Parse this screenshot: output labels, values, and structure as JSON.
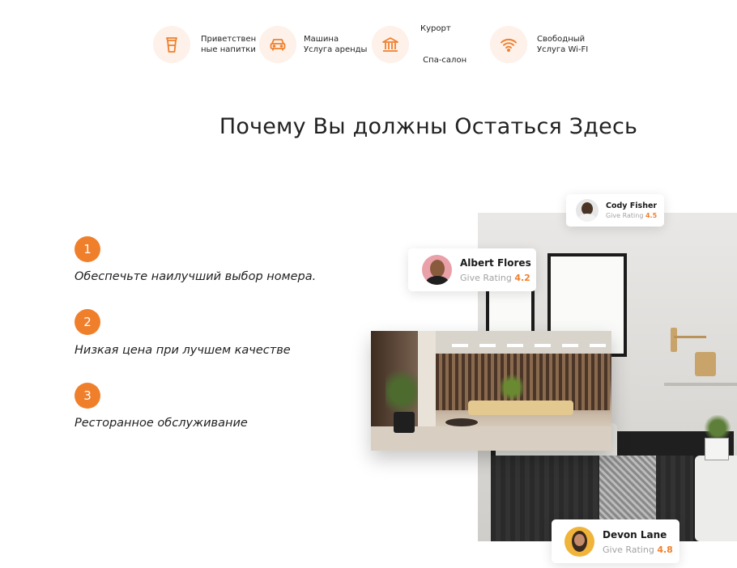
{
  "amenities": [
    {
      "icon": "cup-icon",
      "lines": [
        "Приветствен",
        "ные напитки"
      ]
    },
    {
      "icon": "car-icon",
      "lines": [
        "Машина",
        "Услуга аренды"
      ]
    },
    {
      "icon": "spa-building-icon",
      "lines": [
        "Курорт",
        " Спа-салон"
      ]
    },
    {
      "icon": "wifi-icon",
      "lines": [
        "Свободный",
        "Услуга Wi-FI"
      ]
    }
  ],
  "title": "Почему Вы должны Остаться Здесь",
  "features": [
    {
      "num": "1",
      "text": "Обеспечьте наилучший выбор номера."
    },
    {
      "num": "2",
      "text": "Низкая цена при лучшем качестве"
    },
    {
      "num": "3",
      "text": "Ресторанное обслуживание"
    }
  ],
  "reviews": {
    "cody": {
      "name": "Cody Fisher",
      "label": "Give Rating",
      "rating": "4.5"
    },
    "albert": {
      "name": "Albert Flores",
      "label": "Give Rating",
      "rating": "4.2"
    },
    "devon": {
      "name": "Devon Lane",
      "label": "Give Rating",
      "rating": "4.8"
    }
  },
  "colors": {
    "accent": "#f07f2c",
    "icon_bg": "#fdf1e9"
  }
}
